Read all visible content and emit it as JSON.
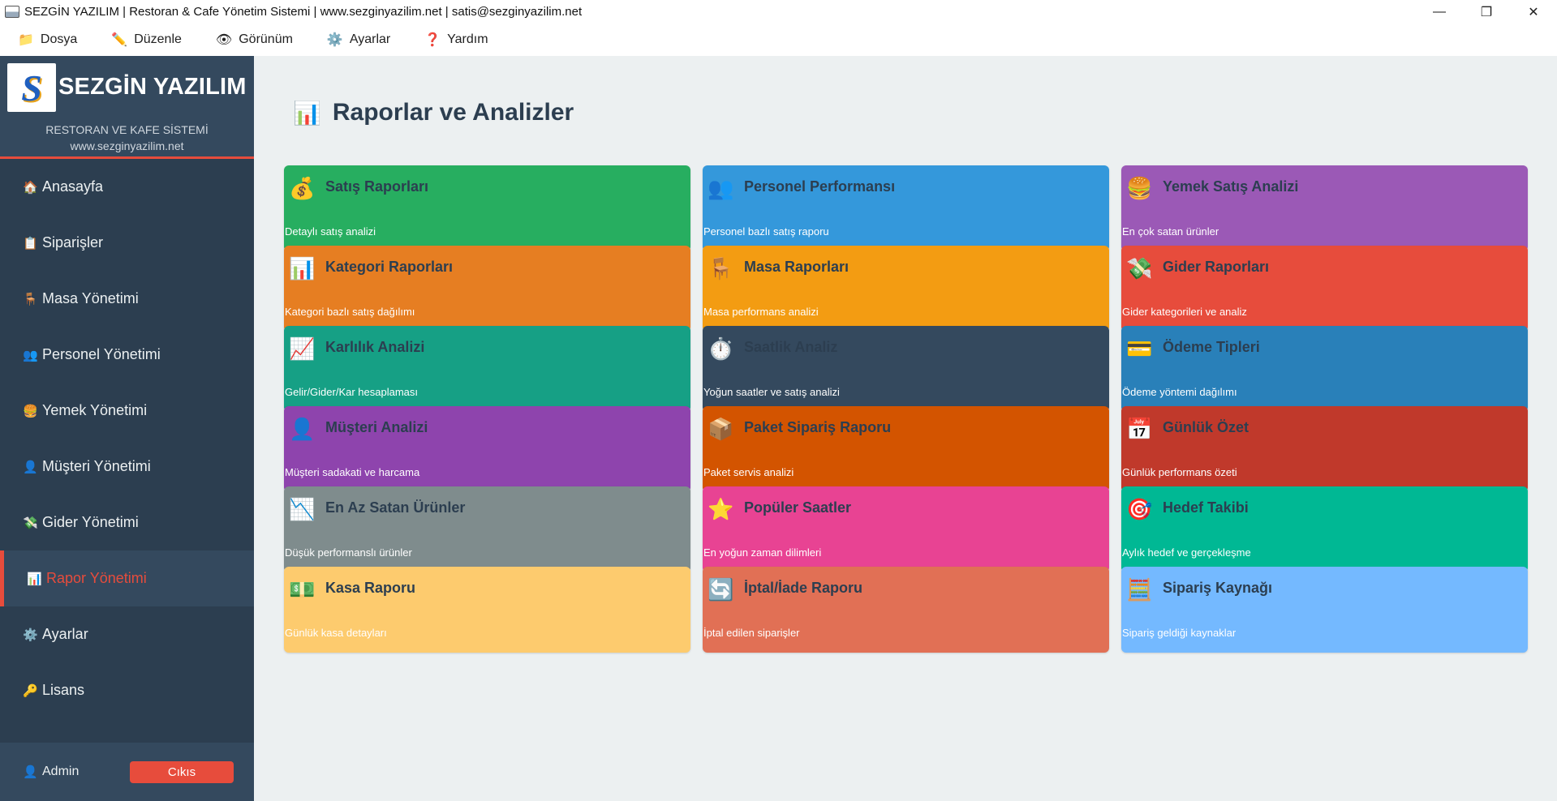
{
  "window": {
    "title": "SEZGİN YAZILIM | Restoran & Cafe Yönetim Sistemi | www.sezginyazilim.net | satis@sezginyazilim.net",
    "controls": [
      "—",
      "❐",
      "✕"
    ]
  },
  "menubar": [
    {
      "icon": "folder-icon",
      "glyph": "📁",
      "label": "Dosya"
    },
    {
      "icon": "pencil-icon",
      "glyph": "✏️",
      "label": "Düzenle"
    },
    {
      "icon": "eye-icon",
      "glyph": "👁",
      "label": "Görünüm"
    },
    {
      "icon": "gear-icon",
      "glyph": "⚙️",
      "label": "Ayarlar"
    },
    {
      "icon": "question-icon",
      "glyph": "❓",
      "label": "Yardım"
    }
  ],
  "sidebar": {
    "brand_name": "SEZGİN YAZILIM",
    "brand_subtitle": "RESTORAN VE KAFE SİSTEMİ",
    "brand_url": "www.sezginyazilim.net",
    "items": [
      {
        "icon": "house-icon",
        "glyph": "🏠",
        "label": "Anasayfa"
      },
      {
        "icon": "clipboard-icon",
        "glyph": "📋",
        "label": "Siparişler"
      },
      {
        "icon": "chair-icon",
        "glyph": "🪑",
        "label": "Masa Yönetimi"
      },
      {
        "icon": "people-icon",
        "glyph": "👥",
        "label": "Personel Yönetimi"
      },
      {
        "icon": "burger-icon",
        "glyph": "🍔",
        "label": "Yemek Yönetimi"
      },
      {
        "icon": "person-icon",
        "glyph": "👤",
        "label": "Müşteri Yönetimi"
      },
      {
        "icon": "money-icon",
        "glyph": "💸",
        "label": "Gider Yönetimi"
      },
      {
        "icon": "chart-icon",
        "glyph": "📊",
        "label": "Rapor Yönetimi",
        "active": true
      },
      {
        "icon": "gear-icon",
        "glyph": "⚙️",
        "label": "Ayarlar"
      },
      {
        "icon": "key-icon",
        "glyph": "🔑",
        "label": "Lisans"
      }
    ],
    "user": {
      "icon": "person-icon",
      "glyph": "👤",
      "name": "Admin"
    },
    "logout_label": "Cıkıs"
  },
  "main": {
    "title_icon": "chart-icon",
    "title_glyph": "📊",
    "title": "Raporlar ve Analizler",
    "cards": [
      {
        "icon": "money-bag-icon",
        "glyph": "💰",
        "title": "Satış Raporları",
        "desc": "Detaylı satış analizi",
        "color": "#27ae60"
      },
      {
        "icon": "people-icon",
        "glyph": "👥",
        "title": "Personel Performansı",
        "desc": "Personel bazlı satış raporu",
        "color": "#3498db"
      },
      {
        "icon": "burger-icon",
        "glyph": "🍔",
        "title": "Yemek Satış Analizi",
        "desc": "En çok satan ürünler",
        "color": "#9b59b6"
      },
      {
        "icon": "bar-chart-icon",
        "glyph": "📊",
        "title": "Kategori Raporları",
        "desc": "Kategori bazlı satış dağılımı",
        "color": "#e67e22"
      },
      {
        "icon": "chair-icon",
        "glyph": "🪑",
        "title": "Masa Raporları",
        "desc": "Masa performans analizi",
        "color": "#f39c12"
      },
      {
        "icon": "money-wings-icon",
        "glyph": "💸",
        "title": "Gider Raporları",
        "desc": "Gider kategorileri ve analiz",
        "color": "#e74c3c"
      },
      {
        "icon": "trend-up-icon",
        "glyph": "📈",
        "title": "Karlılık Analizi",
        "desc": "Gelir/Gider/Kar hesaplaması",
        "color": "#16a085"
      },
      {
        "icon": "stopwatch-icon",
        "glyph": "⏱️",
        "title": "Saatlik Analiz",
        "desc": "Yoğun saatler ve satış analizi",
        "color": "#34495e"
      },
      {
        "icon": "credit-card-icon",
        "glyph": "💳",
        "title": "Ödeme Tipleri",
        "desc": "Ödeme yöntemi dağılımı",
        "color": "#2980b9"
      },
      {
        "icon": "person-icon",
        "glyph": "👤",
        "title": "Müşteri Analizi",
        "desc": "Müşteri sadakati ve harcama",
        "color": "#8e44ad"
      },
      {
        "icon": "package-icon",
        "glyph": "📦",
        "title": "Paket Sipariş Raporu",
        "desc": "Paket servis analizi",
        "color": "#d35400"
      },
      {
        "icon": "calendar-icon",
        "glyph": "📅",
        "title": "Günlük Özet",
        "desc": "Günlük performans özeti",
        "color": "#c0392b"
      },
      {
        "icon": "trend-down-icon",
        "glyph": "📉",
        "title": "En Az Satan Ürünler",
        "desc": "Düşük performanslı ürünler",
        "color": "#7f8c8d"
      },
      {
        "icon": "star-icon",
        "glyph": "⭐",
        "title": "Popüler Saatler",
        "desc": "En yoğun zaman dilimleri",
        "color": "#e84393"
      },
      {
        "icon": "target-icon",
        "glyph": "🎯",
        "title": "Hedef Takibi",
        "desc": "Aylık hedef ve gerçekleşme",
        "color": "#00b894"
      },
      {
        "icon": "cash-icon",
        "glyph": "💵",
        "title": "Kasa Raporu",
        "desc": "Günlük kasa detayları",
        "color": "#fdcb6e"
      },
      {
        "icon": "refresh-icon",
        "glyph": "🔄",
        "title": "İptal/İade Raporu",
        "desc": "İptal edilen siparişler",
        "color": "#e17055"
      },
      {
        "icon": "abacus-icon",
        "glyph": "🧮",
        "title": "Sipariş Kaynağı",
        "desc": "Sipariş geldiği kaynaklar",
        "color": "#74b9ff"
      }
    ]
  }
}
